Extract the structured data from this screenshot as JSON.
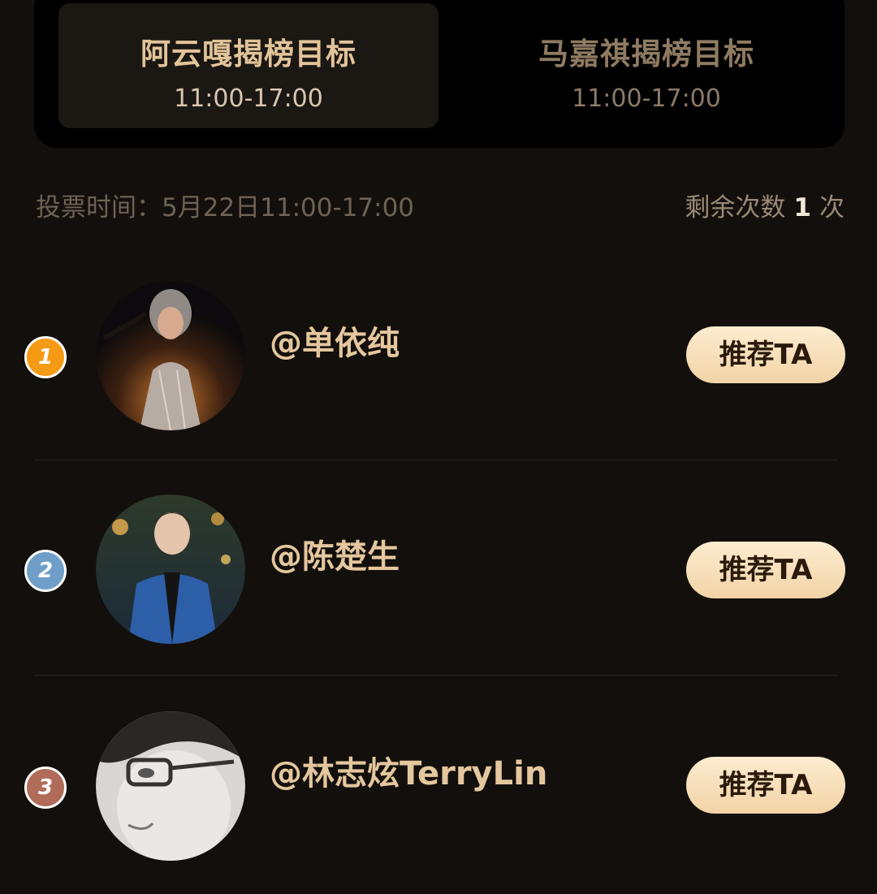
{
  "tabs": [
    {
      "title": "阿云嘎揭榜目标",
      "time": "11:00-17:00"
    },
    {
      "title": "马嘉祺揭榜目标",
      "time": "11:00-17:00"
    }
  ],
  "vote_info": {
    "time_label": "投票时间：",
    "time_value": "5月22日11:00-17:00",
    "remaining_prefix": "剩余次数",
    "remaining_count": "1",
    "remaining_suffix": "次"
  },
  "candidates": [
    {
      "rank": "1",
      "name": "@单依纯",
      "button": "推荐TA",
      "badge_color": "#f59a14"
    },
    {
      "rank": "2",
      "name": "@陈楚生",
      "button": "推荐TA",
      "badge_color": "#6f9fc8"
    },
    {
      "rank": "3",
      "name": "@林志炫TerryLin",
      "button": "推荐TA",
      "badge_color": "#b06c58"
    }
  ],
  "colors": {
    "background": "#130f0c",
    "accent_gold": "#e4c79e",
    "button_gradient_top": "#fcecd0",
    "button_gradient_bottom": "#f2d3a6"
  }
}
